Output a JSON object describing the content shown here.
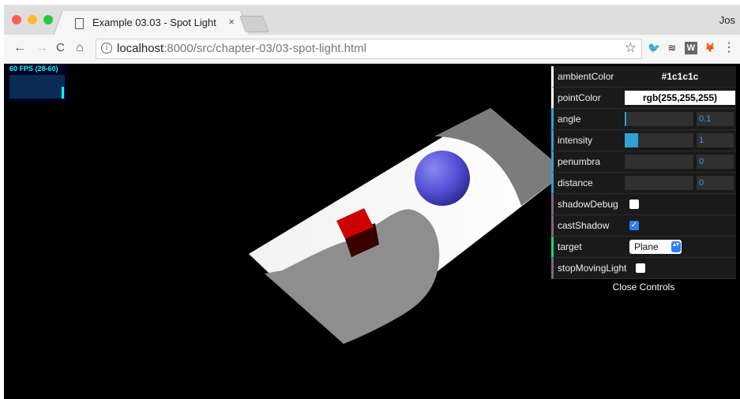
{
  "browser": {
    "tab_title": "Example 03.03 - Spot Light",
    "tab_close": "×",
    "profile_name": "Jos",
    "url_host": "localhost",
    "url_rest": ":8000/src/chapter-03/03-spot-light.html",
    "info_glyph": "i",
    "nav": {
      "back": "←",
      "forward": "→",
      "reload": "C",
      "home": "⌂"
    },
    "star": "☆",
    "extensions": [
      {
        "name": "twitter-icon",
        "glyph": "🐦",
        "color": "#1da1f2"
      },
      {
        "name": "buffer-icon",
        "glyph": "≋",
        "color": "#222222"
      },
      {
        "name": "w-extension-icon",
        "glyph": "W",
        "color": "#666666"
      },
      {
        "name": "metamask-icon",
        "glyph": "🦊",
        "color": "#f6851b"
      }
    ],
    "menu_glyph": "⋮",
    "traffic_lights": {
      "close": "#fc5f57",
      "minimize": "#fdbc2e",
      "zoom": "#28c840"
    }
  },
  "stats": {
    "label": "60 FPS (28-60)"
  },
  "controls": {
    "ambientColor": {
      "label": "ambientColor",
      "value": "#1c1c1c",
      "swatch": "#1c1c1c",
      "text_color": "#ffffff"
    },
    "pointColor": {
      "label": "pointColor",
      "value": "rgb(255,255,255)",
      "swatch": "#ffffff",
      "text_color": "#000000"
    },
    "angle": {
      "label": "angle",
      "value": "0.1",
      "fraction": 0.02
    },
    "intensity": {
      "label": "intensity",
      "value": "1",
      "fraction": 0.2
    },
    "penumbra": {
      "label": "penumbra",
      "value": "0",
      "fraction": 0
    },
    "distance": {
      "label": "distance",
      "value": "0",
      "fraction": 0
    },
    "shadowDebug": {
      "label": "shadowDebug",
      "checked": false
    },
    "castShadow": {
      "label": "castShadow",
      "checked": true,
      "checkmark": "✓"
    },
    "target": {
      "label": "target",
      "selected": "Plane",
      "arrow": "▴▾"
    },
    "stopMovingLight": {
      "label": "stopMovingLight",
      "checked": false
    },
    "close_label": "Close Controls"
  }
}
